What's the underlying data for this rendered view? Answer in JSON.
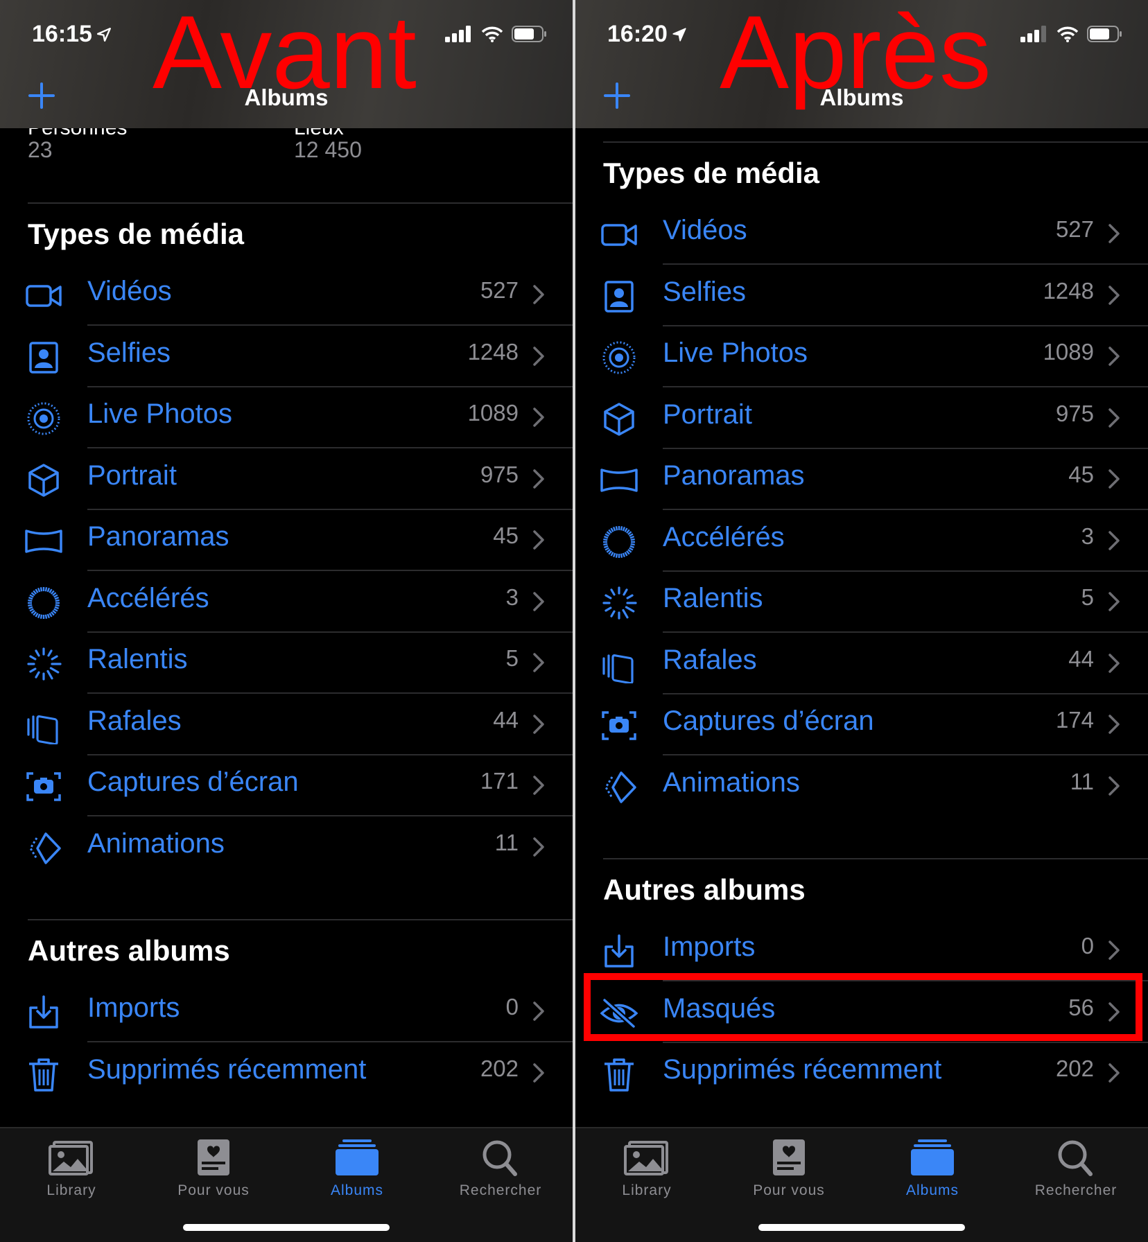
{
  "colors": {
    "accent": "#3a86f7",
    "annotation": "#ff0000",
    "secondary": "#8e8e93"
  },
  "left": {
    "time": "16:15",
    "annotation": "Avant",
    "nav_title": "Albums",
    "prev_titles": [
      "Personnes",
      "Lieux"
    ],
    "prev_counts": [
      "23",
      "12 450"
    ],
    "section_media": "Types de média",
    "media": [
      {
        "icon": "video-icon",
        "label": "Vidéos",
        "count": "527"
      },
      {
        "icon": "selfie-icon",
        "label": "Selfies",
        "count": "1248"
      },
      {
        "icon": "live-photo-icon",
        "label": "Live Photos",
        "count": "1089"
      },
      {
        "icon": "portrait-cube-icon",
        "label": "Portrait",
        "count": "975"
      },
      {
        "icon": "panorama-icon",
        "label": "Panoramas",
        "count": "45"
      },
      {
        "icon": "timelapse-icon",
        "label": "Accélérés",
        "count": "3"
      },
      {
        "icon": "slowmo-icon",
        "label": "Ralentis",
        "count": "5"
      },
      {
        "icon": "burst-icon",
        "label": "Rafales",
        "count": "44"
      },
      {
        "icon": "screenshot-icon",
        "label": "Captures d’écran",
        "count": "171"
      },
      {
        "icon": "animated-icon",
        "label": "Animations",
        "count": "11"
      }
    ],
    "section_other": "Autres albums",
    "other": [
      {
        "icon": "import-icon",
        "label": "Imports",
        "count": "0"
      },
      {
        "icon": "trash-icon",
        "label": "Supprimés récemment",
        "count": "202"
      }
    ]
  },
  "right": {
    "time": "16:20",
    "annotation": "Après",
    "nav_title": "Albums",
    "section_media": "Types de média",
    "media": [
      {
        "icon": "video-icon",
        "label": "Vidéos",
        "count": "527"
      },
      {
        "icon": "selfie-icon",
        "label": "Selfies",
        "count": "1248"
      },
      {
        "icon": "live-photo-icon",
        "label": "Live Photos",
        "count": "1089"
      },
      {
        "icon": "portrait-cube-icon",
        "label": "Portrait",
        "count": "975"
      },
      {
        "icon": "panorama-icon",
        "label": "Panoramas",
        "count": "45"
      },
      {
        "icon": "timelapse-icon",
        "label": "Accélérés",
        "count": "3"
      },
      {
        "icon": "slowmo-icon",
        "label": "Ralentis",
        "count": "5"
      },
      {
        "icon": "burst-icon",
        "label": "Rafales",
        "count": "44"
      },
      {
        "icon": "screenshot-icon",
        "label": "Captures d’écran",
        "count": "174"
      },
      {
        "icon": "animated-icon",
        "label": "Animations",
        "count": "11"
      }
    ],
    "section_other": "Autres albums",
    "other": [
      {
        "icon": "import-icon",
        "label": "Imports",
        "count": "0"
      },
      {
        "icon": "hidden-eye-icon",
        "label": "Masqués",
        "count": "56"
      },
      {
        "icon": "trash-icon",
        "label": "Supprimés récemment",
        "count": "202"
      }
    ]
  },
  "tabs": [
    {
      "icon": "library-icon",
      "label": "Library"
    },
    {
      "icon": "for-you-icon",
      "label": "Pour vous"
    },
    {
      "icon": "albums-icon",
      "label": "Albums"
    },
    {
      "icon": "search-icon",
      "label": "Rechercher"
    }
  ]
}
